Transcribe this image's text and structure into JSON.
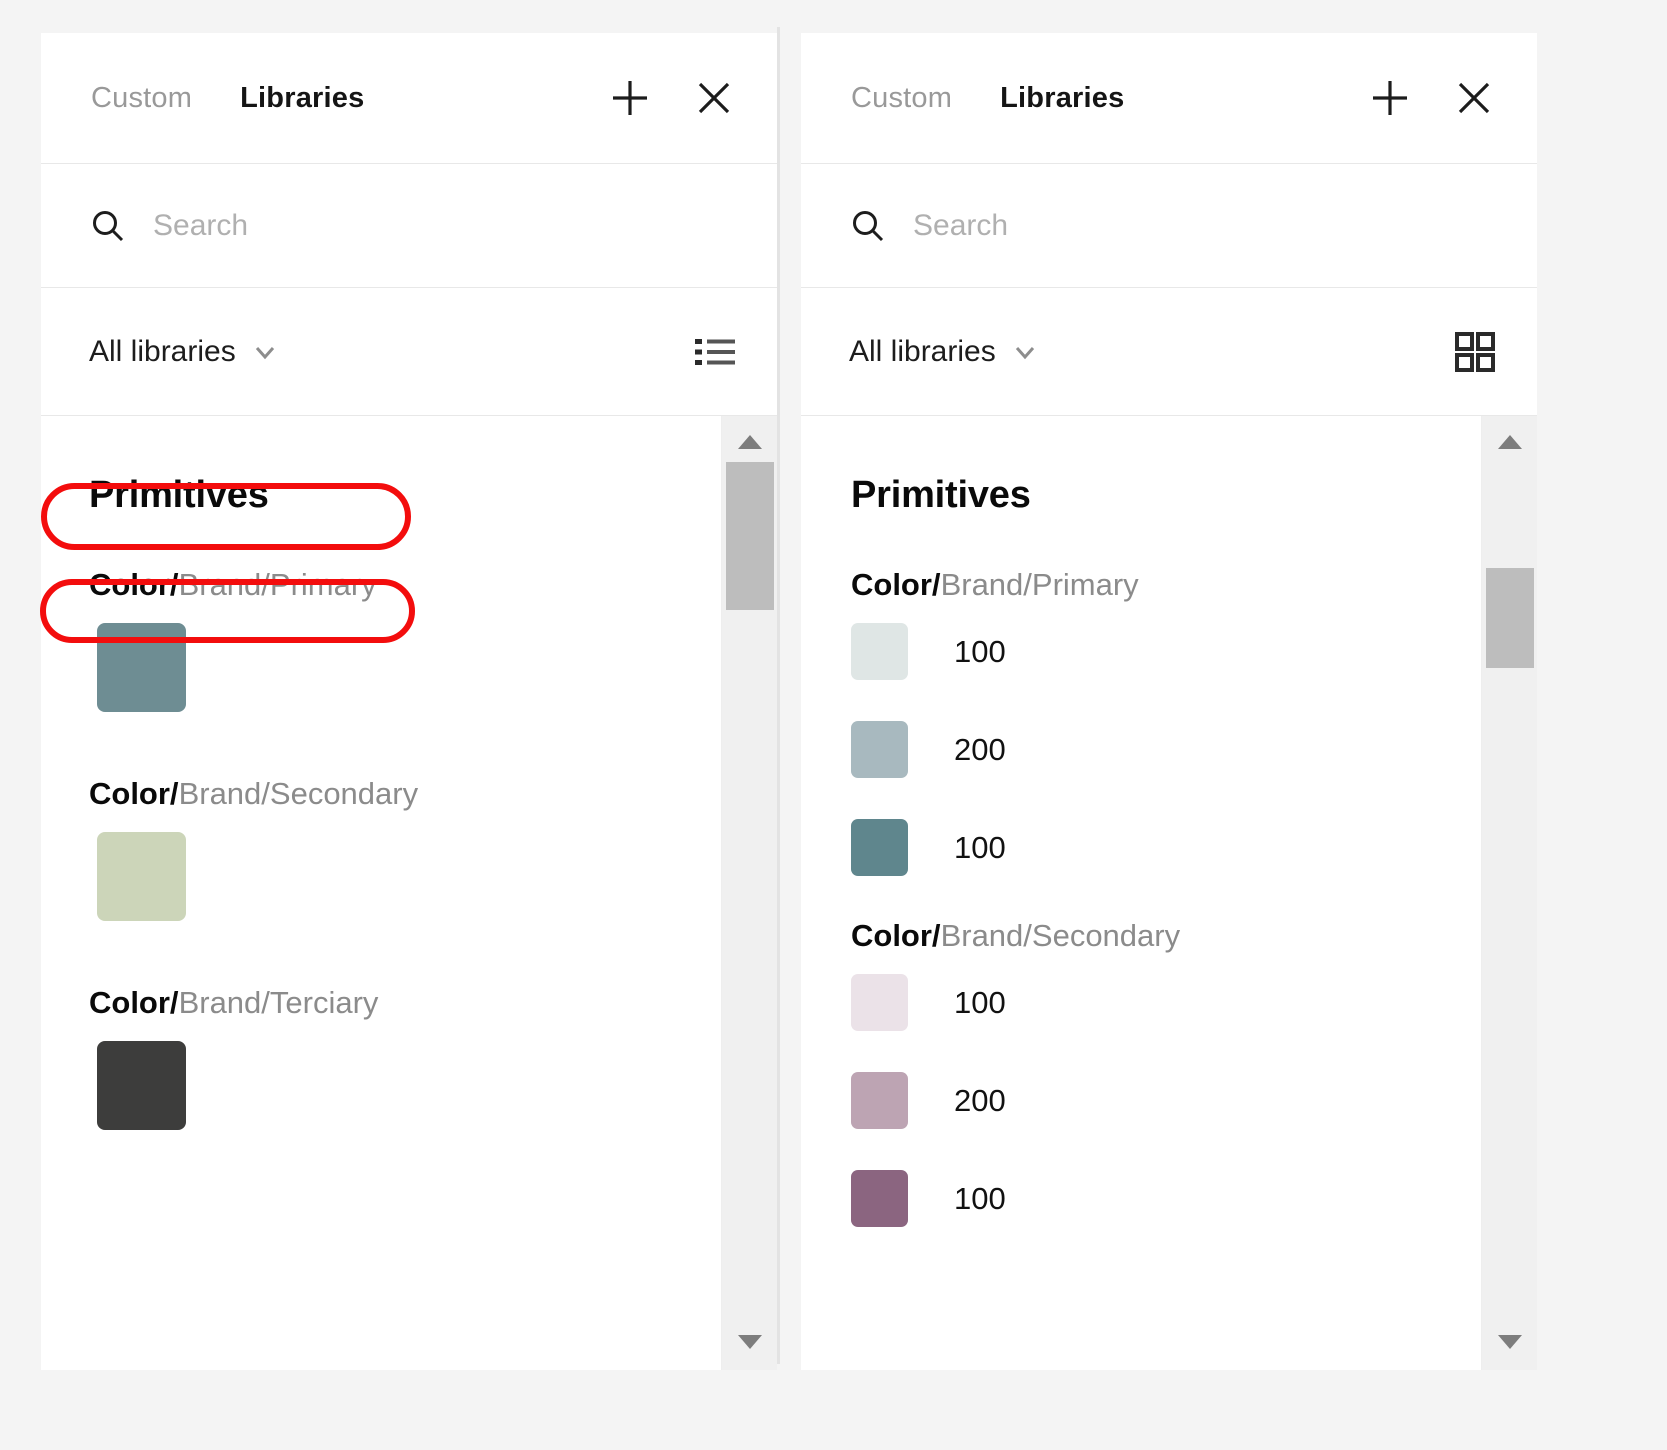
{
  "panels": [
    {
      "id": "left",
      "header": {
        "tab_inactive": "Custom",
        "tab_active": "Libraries",
        "add_icon": "plus-icon",
        "close_icon": "close-icon"
      },
      "search": {
        "placeholder": "Search",
        "value": "",
        "icon": "search-icon"
      },
      "filter": {
        "label": "All libraries",
        "chevron_icon": "chevron-down-icon",
        "view_mode": "list",
        "view_icon": "list-view-icon"
      },
      "section_title": "Primitives",
      "groups": [
        {
          "prefix": "Color/",
          "suffix": "Brand/Primary",
          "swatch": "#6e8d93"
        },
        {
          "prefix": "Color/",
          "suffix": "Brand/Secondary",
          "swatch": "#ccd5b9"
        },
        {
          "prefix": "Color/",
          "suffix": "Brand/Terciary",
          "swatch": "#3d3d3c"
        }
      ]
    },
    {
      "id": "right",
      "header": {
        "tab_inactive": "Custom",
        "tab_active": "Libraries",
        "add_icon": "plus-icon",
        "close_icon": "close-icon"
      },
      "search": {
        "placeholder": "Search",
        "value": "",
        "icon": "search-icon"
      },
      "filter": {
        "label": "All libraries",
        "chevron_icon": "chevron-down-icon",
        "view_mode": "grid",
        "view_icon": "grid-view-icon"
      },
      "section_title": "Primitives",
      "groups": [
        {
          "prefix": "Color/",
          "suffix": "Brand/Primary",
          "tones": [
            {
              "label": "100",
              "swatch": "#dfe6e5"
            },
            {
              "label": "200",
              "swatch": "#a8b9bf"
            },
            {
              "label": "100",
              "swatch": "#5f868d"
            }
          ]
        },
        {
          "prefix": "Color/",
          "suffix": "Brand/Secondary",
          "tones": [
            {
              "label": "100",
              "swatch": "#ebe2e8"
            },
            {
              "label": "200",
              "swatch": "#bda4b3"
            },
            {
              "label": "100",
              "swatch": "#8b6580"
            }
          ]
        }
      ]
    }
  ],
  "annotations": [
    {
      "name": "highlight-primitives",
      "target": "Primitives",
      "color": "#f30d0d"
    },
    {
      "name": "highlight-color-brand-primary",
      "target": "Color/Brand/Primary",
      "color": "#f30d0d"
    }
  ],
  "scrollbars": {
    "up_arrow_icon": "triangle-up-icon",
    "down_arrow_icon": "triangle-down-icon"
  }
}
